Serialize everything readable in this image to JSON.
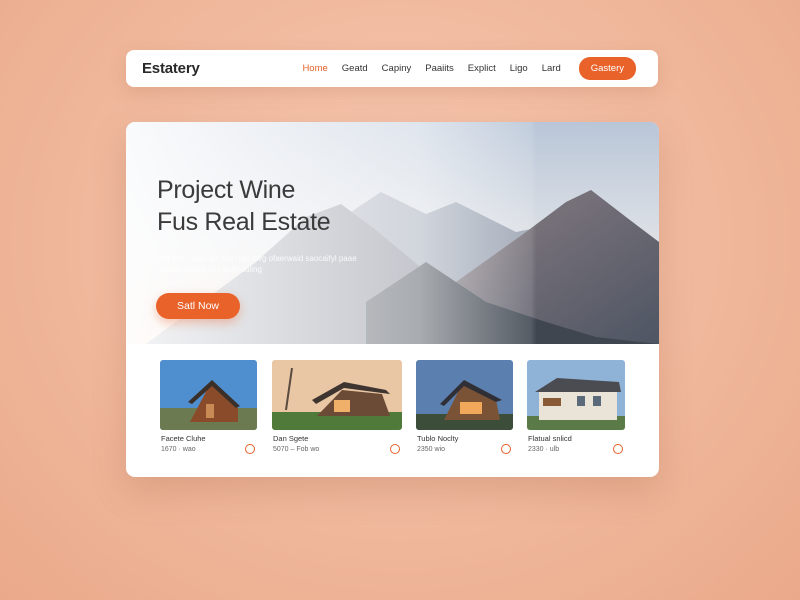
{
  "brand": "Estatery",
  "nav": {
    "links": [
      "Home",
      "Geatd",
      "Capiny",
      "Paaiits",
      "Explict",
      "Ligo",
      "Lard"
    ],
    "active": "Home",
    "cta": "Gastery"
  },
  "hero": {
    "title_line1": "Project Wine",
    "title_line2": "Fus Real Estate",
    "subtitle": "Llnr fcfiu cfam atr sho rtah lovg ofaerwaid saocaifyl paae mfimpt cheud uoe pofe-caling",
    "cta": "Satl Now"
  },
  "listings": [
    {
      "name": "Facete Cluhe",
      "price": "1670 · wao"
    },
    {
      "name": "Dan Sgete",
      "price": "5070 – Fob wo"
    },
    {
      "name": "Tublo Noclty",
      "price": "2350 wio"
    },
    {
      "name": "Flatual snlicd",
      "price": "2330 · ulb"
    }
  ],
  "colors": {
    "accent": "#e8622a",
    "background": "#f2bda2"
  }
}
